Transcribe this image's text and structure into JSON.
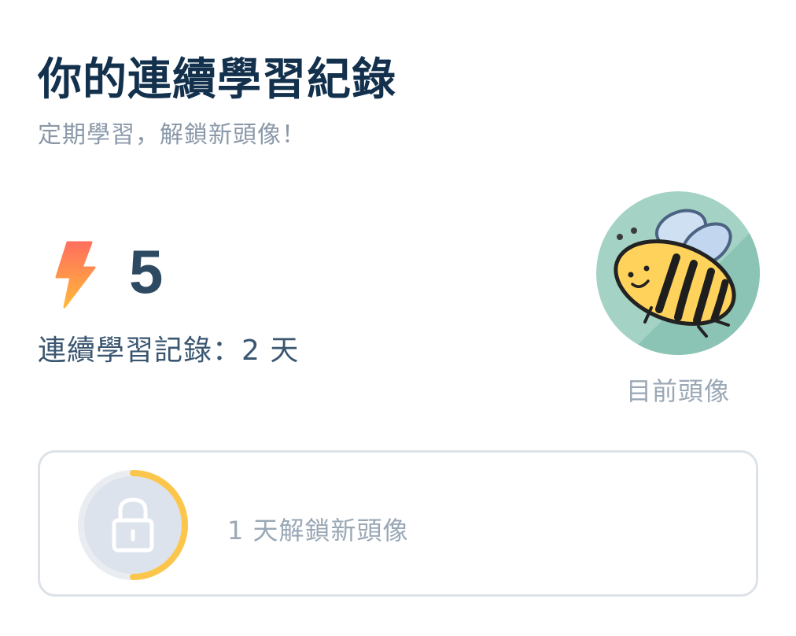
{
  "header": {
    "title": "你的連續學習紀錄",
    "subtitle": "定期學習，解鎖新頭像！"
  },
  "streak": {
    "icon": "lightning-bolt-icon",
    "count": "5",
    "record_text": "連續學習記錄：2 天"
  },
  "avatar": {
    "image": "bee-avatar",
    "label": "目前頭像"
  },
  "unlock": {
    "icon": "lock-icon",
    "text": "1 天解鎖新頭像",
    "progress": 0.5
  },
  "colors": {
    "title": "#13314d",
    "subtitle": "#8a98a8",
    "accent_ring": "#fcc64d",
    "avatar_bg": "#9fcfc0",
    "bolt_top": "#ff7a5c",
    "bolt_bottom": "#ffb13b"
  }
}
